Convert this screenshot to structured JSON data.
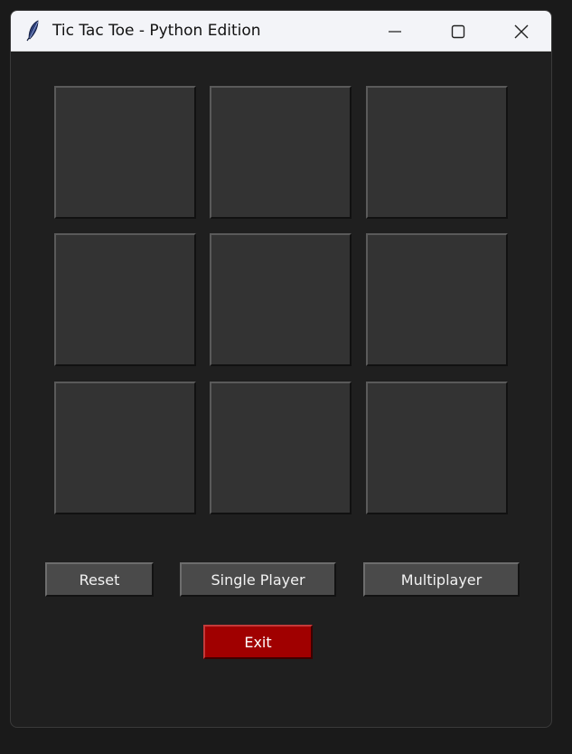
{
  "window": {
    "title": "Tic Tac Toe - Python Edition",
    "icon": "feather-icon",
    "controls": [
      "minimize-icon",
      "maximize-icon",
      "close-icon"
    ]
  },
  "board": {
    "cells": [
      "",
      "",
      "",
      "",
      "",
      "",
      "",
      "",
      ""
    ]
  },
  "buttons": {
    "reset_label": "Reset",
    "single_player_label": "Single Player",
    "multiplayer_label": "Multiplayer",
    "exit_label": "Exit"
  },
  "colors": {
    "window_bg": "#1f1f1f",
    "cell_bg": "#333333",
    "button_bg": "#4a4a4a",
    "exit_bg": "#a00000",
    "titlebar_bg": "#f3f4f8"
  }
}
